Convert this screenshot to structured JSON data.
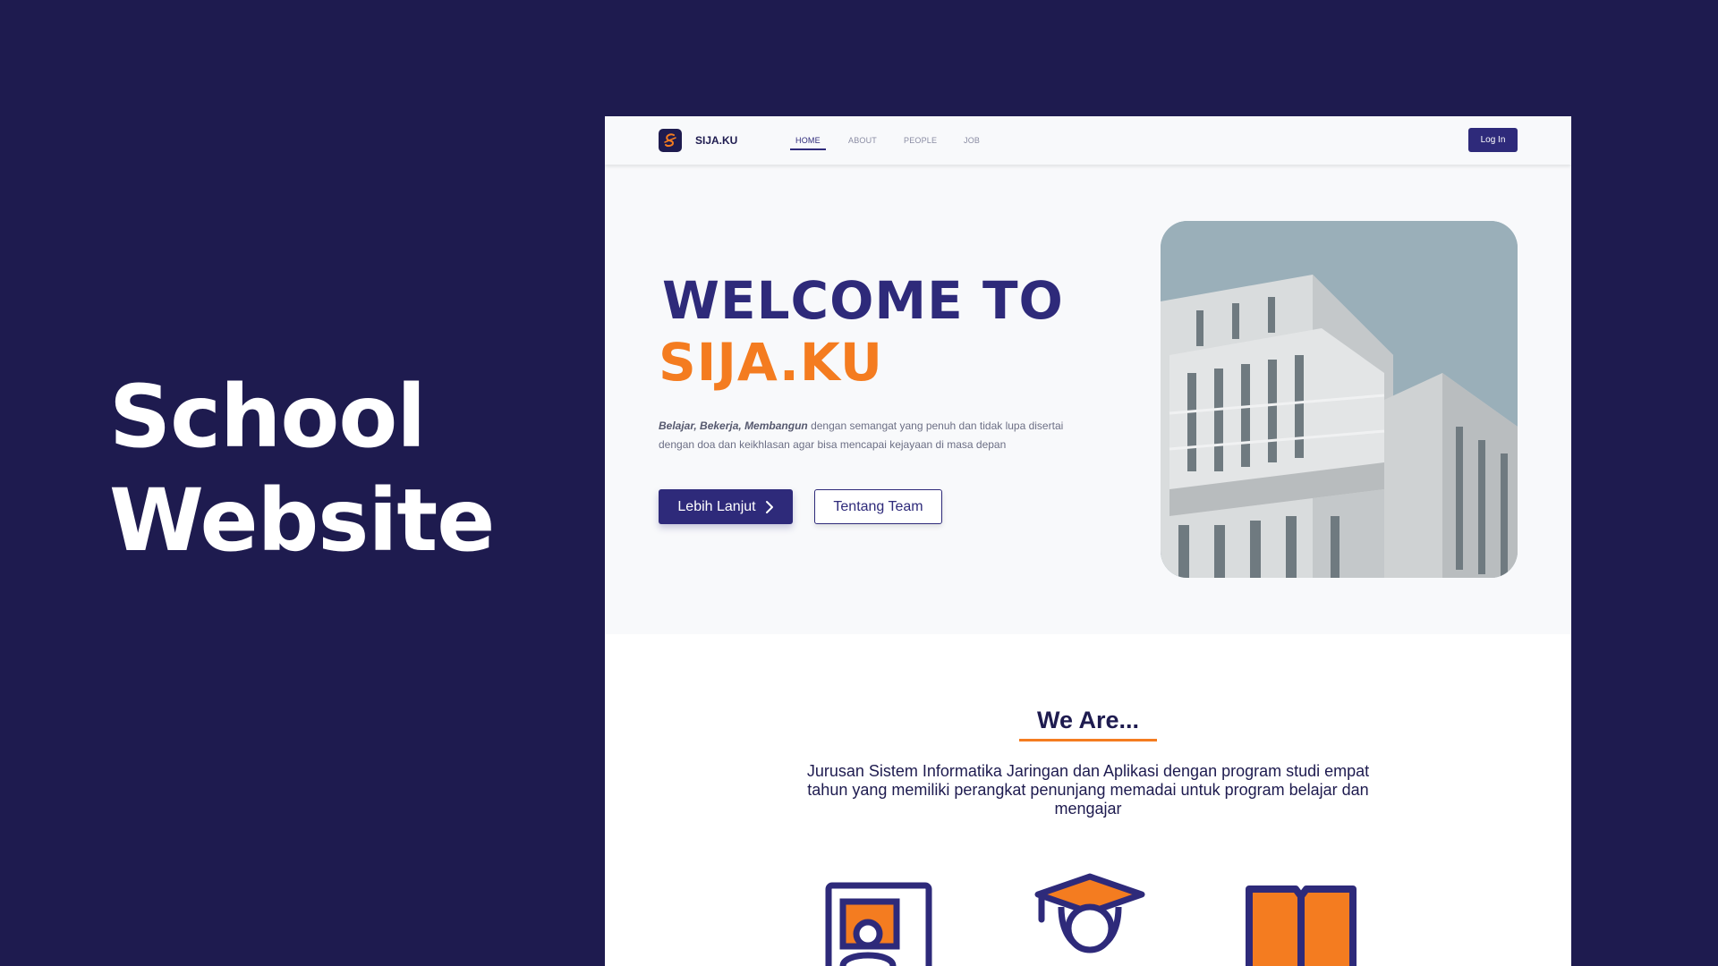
{
  "showcase": {
    "title_line1": "School",
    "title_line2": "Website"
  },
  "nav": {
    "brand": "SIJA.KU",
    "links": [
      "HOME",
      "ABOUT",
      "PEOPLE",
      "JOB"
    ],
    "active": "HOME",
    "login_label": "Log In"
  },
  "hero": {
    "title_line1": "WELCOME TO",
    "title_line2": "SIJA.KU",
    "desc_bold": "Belajar, Bekerja, Membangun",
    "desc_text": " dengan semangat yang penuh dan tidak lupa disertai dengan doa dan keikhlasan agar bisa mencapai kejayaan di masa depan",
    "primary_button": "Lebih Lanjut",
    "secondary_button": "Tentang Team"
  },
  "about": {
    "title": "We Are...",
    "text": "Jurusan Sistem Informatika Jaringan dan Aplikasi dengan program studi empat tahun yang memiliki perangkat penunjang memadai untuk program belajar dan mengajar"
  },
  "colors": {
    "background": "#1e1b4f",
    "primary": "#2e2a7a",
    "accent": "#f47c20"
  },
  "icons": [
    "presentation-icon",
    "graduate-icon",
    "book-icon"
  ]
}
